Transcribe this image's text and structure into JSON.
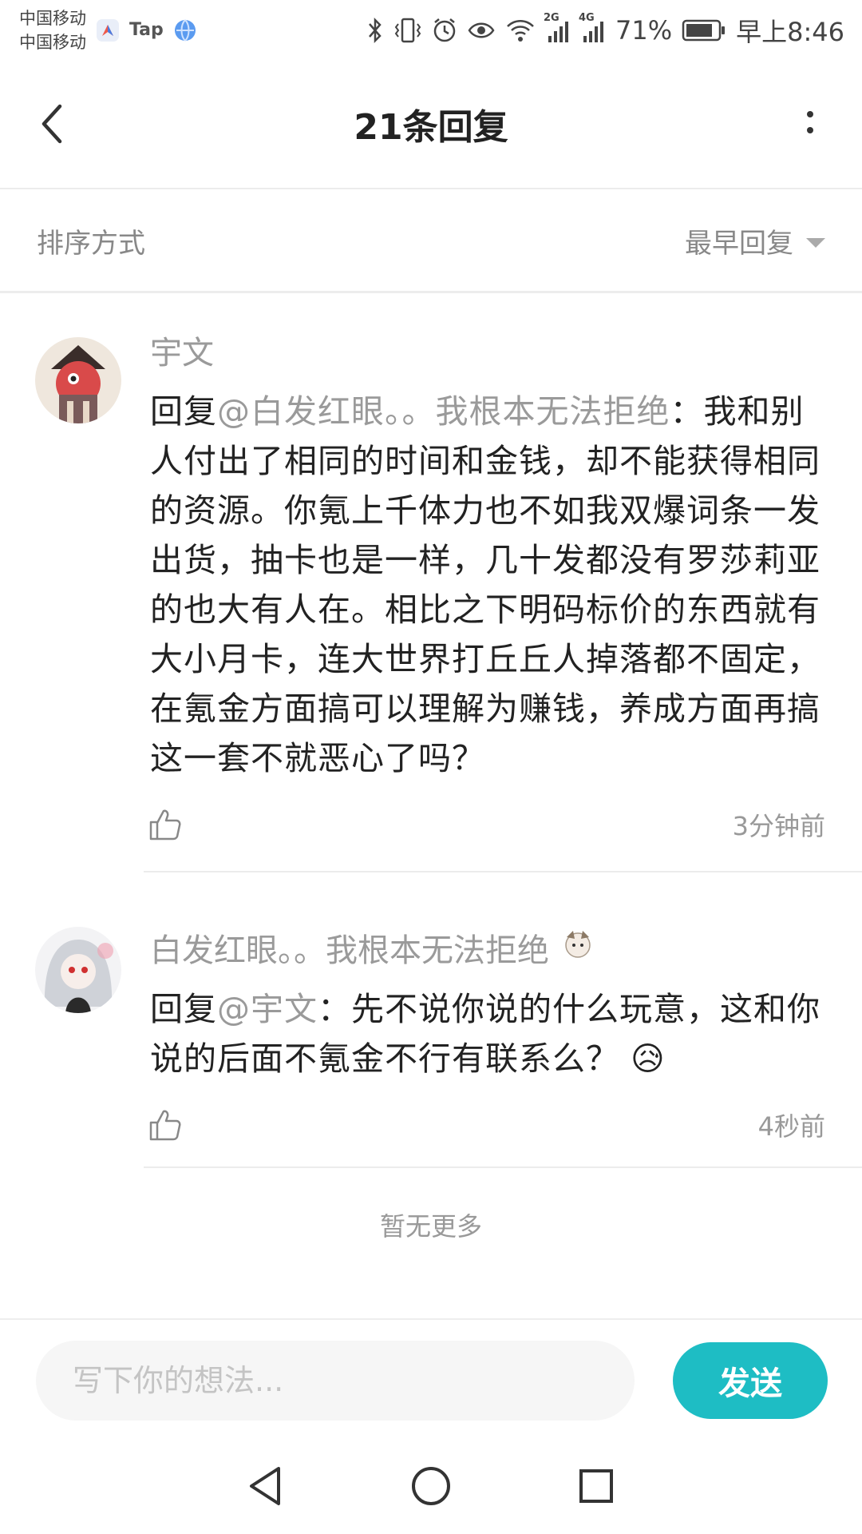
{
  "status_bar": {
    "carrier_1": "中国移动",
    "carrier_2": "中国移动",
    "app_label": "Tap",
    "net_2g": "2G",
    "net_4g": "4G",
    "battery": "71%",
    "time": "早上8:46"
  },
  "header": {
    "title": "21条回复"
  },
  "sort": {
    "label": "排序方式",
    "selected": "最早回复"
  },
  "comments": [
    {
      "author": "宇文",
      "reply_prefix": "回复",
      "mention": "@白发红眼。。我根本无法拒绝",
      "text": "：我和别人付出了相同的时间和金钱，却不能获得相同的资源。你氪上千体力也不如我双爆词条一发出货，抽卡也是一样，几十发都没有罗莎莉亚的也大有人在。相比之下明码标价的东西就有大小月卡，连大世界打丘丘人掉落都不固定，在氪金方面搞可以理解为赚钱，养成方面再搞这一套不就恶心了吗？",
      "time": "3分钟前"
    },
    {
      "author": "白发红眼。。我根本无法拒绝",
      "reply_prefix": "回复",
      "mention": "@宇文",
      "text": "：先不说你说的什么玩意，这和你说的后面不氪金不行有联系么？",
      "emoji": "😥",
      "time": "4秒前"
    }
  ],
  "footer_note": "暂无更多",
  "input": {
    "placeholder": "写下你的想法...",
    "value": ""
  },
  "send_label": "发送",
  "colors": {
    "accent": "#1ebdc4",
    "muted_text": "#9a9a9a"
  }
}
